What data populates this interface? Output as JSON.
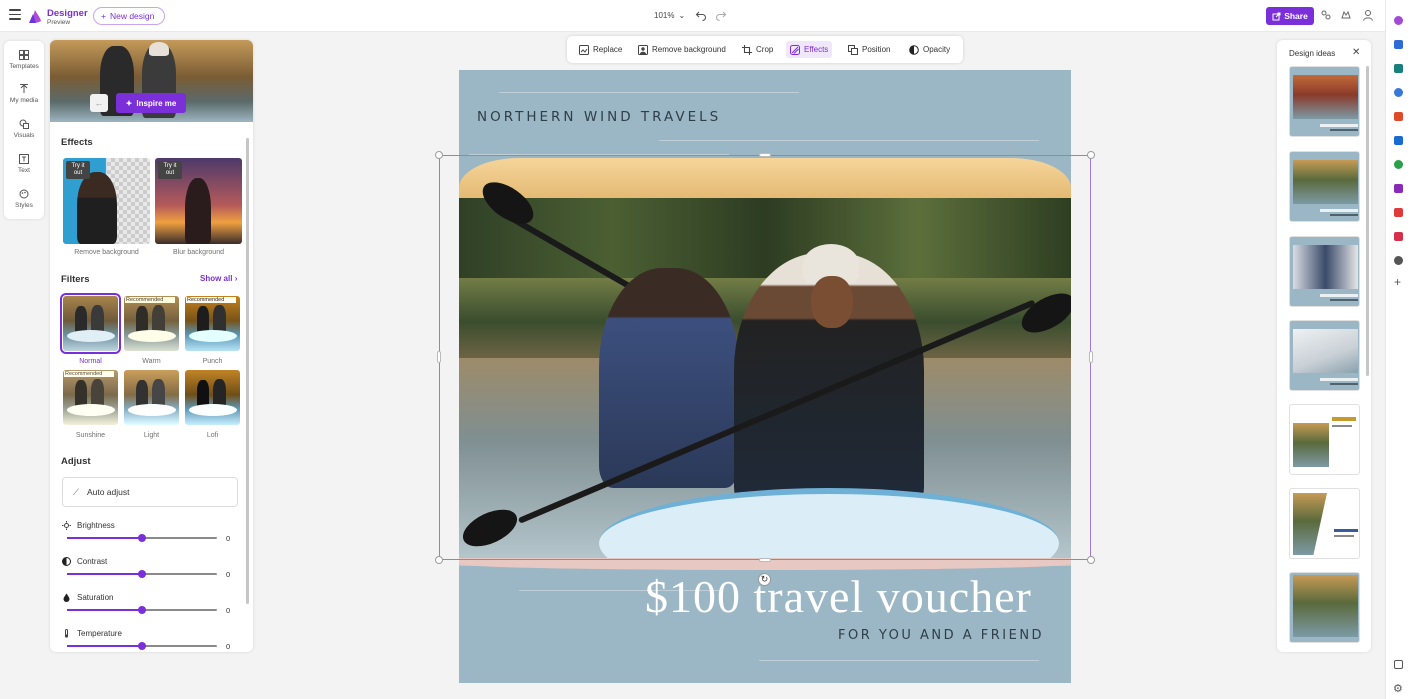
{
  "app": {
    "name": "Designer",
    "badge": "Preview",
    "new_design": "New design"
  },
  "toolbar": {
    "zoom": "101%",
    "share": "Share"
  },
  "rail": [
    {
      "label": "Templates"
    },
    {
      "label": "My media"
    },
    {
      "label": "Visuals"
    },
    {
      "label": "Text"
    },
    {
      "label": "Styles"
    }
  ],
  "panel": {
    "inspire": "Inspire me",
    "effects_title": "Effects",
    "effects": [
      {
        "tag": "Try it out",
        "label": "Remove background"
      },
      {
        "tag": "Try it out",
        "label": "Blur background"
      }
    ],
    "filters_title": "Filters",
    "show_all": "Show all",
    "filters": [
      {
        "label": "Normal",
        "badge": "",
        "selected": true
      },
      {
        "label": "Warm",
        "badge": "Recommended",
        "selected": false
      },
      {
        "label": "Punch",
        "badge": "Recommended",
        "selected": false
      },
      {
        "label": "Sunshine",
        "badge": "Recommended",
        "selected": false
      },
      {
        "label": "Light",
        "badge": "",
        "selected": false
      },
      {
        "label": "Lofi",
        "badge": "",
        "selected": false
      }
    ],
    "adjust_title": "Adjust",
    "auto_adjust": "Auto adjust",
    "sliders": [
      {
        "label": "Brightness",
        "value": "0",
        "level": 0.5
      },
      {
        "label": "Contrast",
        "value": "0",
        "level": 0.5
      },
      {
        "label": "Saturation",
        "value": "0",
        "level": 0.5
      },
      {
        "label": "Temperature",
        "value": "0",
        "level": 0.5
      }
    ]
  },
  "context_toolbar": [
    {
      "label": "Replace",
      "icon": "replace-icon"
    },
    {
      "label": "Remove background",
      "icon": "remove-background-icon"
    },
    {
      "label": "Crop",
      "icon": "crop-icon"
    },
    {
      "label": "Effects",
      "icon": "effects-icon",
      "active": true
    },
    {
      "label": "Position",
      "icon": "position-icon"
    },
    {
      "label": "Opacity",
      "icon": "opacity-icon"
    }
  ],
  "canvas": {
    "headline": "NORTHERN WIND TRAVELS",
    "voucher": "$100 travel voucher",
    "subline": "FOR YOU AND A FRIEND"
  },
  "ideas": {
    "title": "Design ideas",
    "count": 7
  },
  "colors": {
    "accent": "#7b2fd8",
    "canvas_bg": "#9bb6c4"
  }
}
